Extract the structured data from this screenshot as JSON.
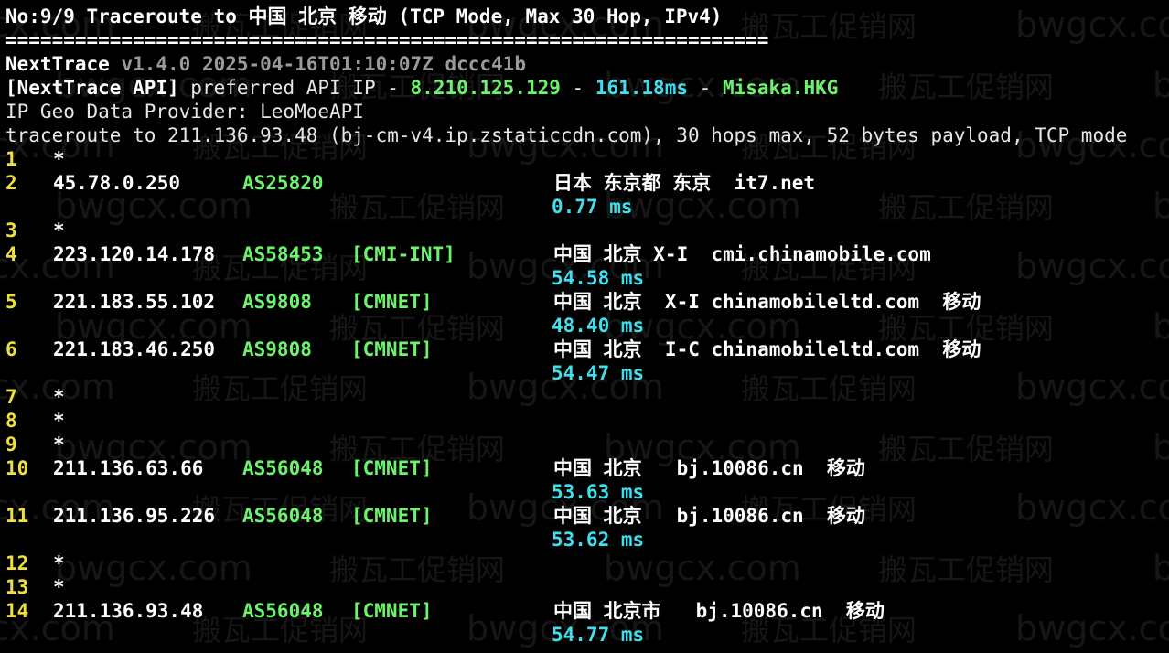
{
  "header": {
    "title": "No:9/9 Traceroute to 中国 北京 移动 (TCP Mode, Max 30 Hop, IPv4)",
    "separator": "==================================================================",
    "app_name": "NextTrace",
    "version_info": "v1.4.0 2025-04-16T01:10:07Z dccc41b",
    "api_label": "[NextTrace API]",
    "api_text": " preferred API IP - ",
    "api_ip": "8.210.125.129",
    "api_dash1": " - ",
    "api_latency": "161.18ms",
    "api_dash2": " - ",
    "api_node": "Misaka.HKG",
    "geo_provider": "IP Geo Data Provider: LeoMoeAPI",
    "trace_info": "traceroute to 211.136.93.48 (bj-cm-v4.ip.zstaticcdn.com), 30 hops max, 52 bytes payload, TCP mode"
  },
  "hops": {
    "h1": {
      "num": "1",
      "star": "*"
    },
    "h2": {
      "num": "2",
      "ip": "45.78.0.250",
      "as": "AS25820",
      "tag": "",
      "geo": "日本 东京都 东京  it7.net",
      "rtt": "0.77 ms"
    },
    "h3": {
      "num": "3",
      "star": "*"
    },
    "h4": {
      "num": "4",
      "ip": "223.120.14.178",
      "as": "AS58453",
      "tag": "[CMI-INT]",
      "geo": "中国 北京 X-I  cmi.chinamobile.com",
      "rtt": "54.58 ms"
    },
    "h5": {
      "num": "5",
      "ip": "221.183.55.102",
      "as": "AS9808",
      "tag": "[CMNET]",
      "geo": "中国 北京  X-I chinamobileltd.com  移动",
      "rtt": "48.40 ms"
    },
    "h6": {
      "num": "6",
      "ip": "221.183.46.250",
      "as": "AS9808",
      "tag": "[CMNET]",
      "geo": "中国 北京  I-C chinamobileltd.com  移动",
      "rtt": "54.47 ms"
    },
    "h7": {
      "num": "7",
      "star": "*"
    },
    "h8": {
      "num": "8",
      "star": "*"
    },
    "h9": {
      "num": "9",
      "star": "*"
    },
    "h10": {
      "num": "10",
      "ip": "211.136.63.66",
      "as": "AS56048",
      "tag": "[CMNET]",
      "geo": "中国 北京   bj.10086.cn  移动",
      "rtt": "53.63 ms"
    },
    "h11": {
      "num": "11",
      "ip": "211.136.95.226",
      "as": "AS56048",
      "tag": "[CMNET]",
      "geo": "中国 北京   bj.10086.cn  移动",
      "rtt": "53.62 ms"
    },
    "h12": {
      "num": "12",
      "star": "*"
    },
    "h13": {
      "num": "13",
      "star": "*"
    },
    "h14": {
      "num": "14",
      "ip": "211.136.93.48",
      "as": "AS56048",
      "tag": "[CMNET]",
      "geo": "中国 北京市   bj.10086.cn  移动",
      "rtt": "54.77 ms"
    }
  },
  "watermark": {
    "site": "bwgcx.com",
    "cn": "搬瓦工促销网"
  },
  "colors": {
    "background": "#000000",
    "ip_as": "#6cf36c",
    "rtt": "#3fe0ee",
    "hop_num": "#f0e03c"
  }
}
